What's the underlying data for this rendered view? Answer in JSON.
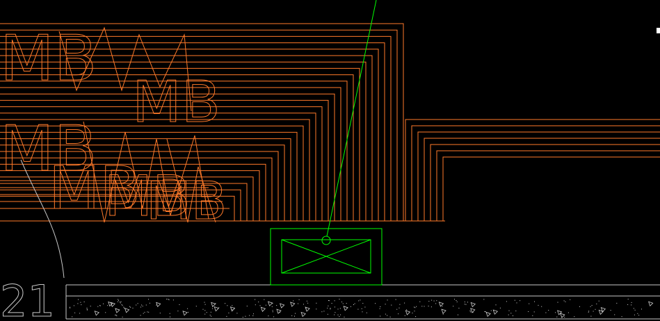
{
  "viewport": {
    "background": "#000000",
    "colors": {
      "wiring": "#ff7a2a",
      "fixture": "#00ff00",
      "slab": "#c8c8c8",
      "aggregate": "#d0d0d0"
    }
  },
  "annotations": {
    "circuit_tag_a": "MB",
    "circuit_tag_b": "MB",
    "circuit_tag_c": "MB",
    "circuit_tag_d": "MB",
    "circuit_tag_e": "MB",
    "circuit_tag_f": "MB",
    "dimension_text": "21"
  },
  "fixture": {
    "icon": "light-fixture-x-box-icon"
  }
}
